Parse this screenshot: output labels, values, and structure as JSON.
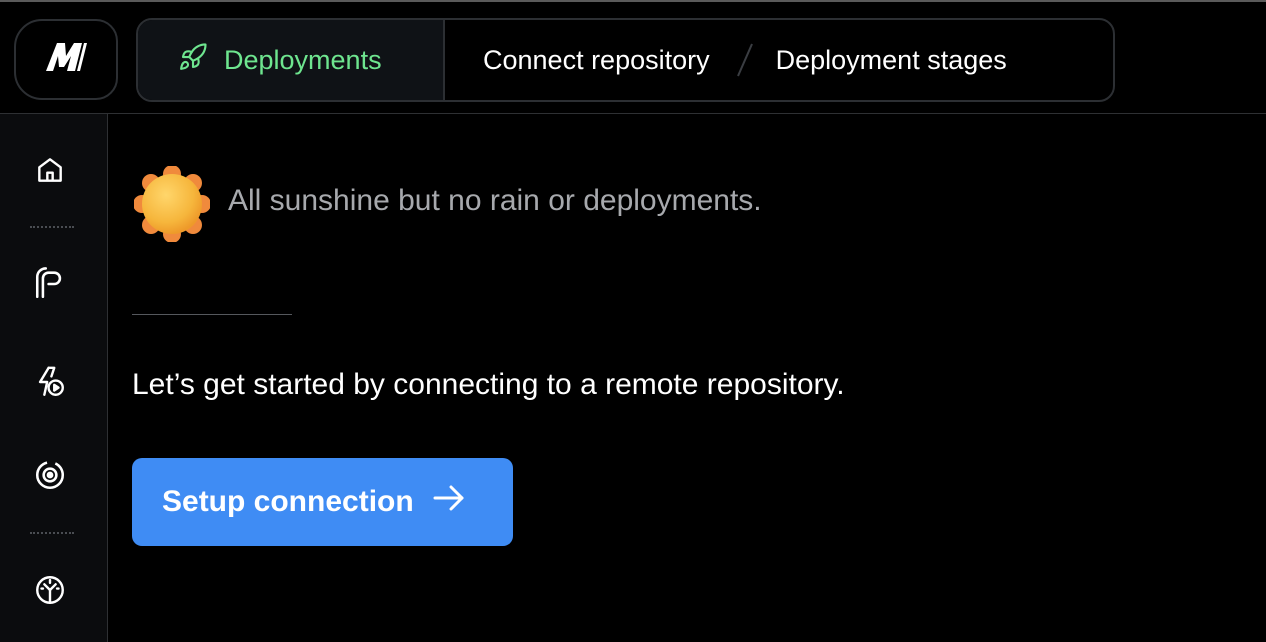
{
  "header": {
    "logo_icon": "brand-logo-icon",
    "tabs": [
      {
        "label": "Deployments",
        "icon": "rocket-icon",
        "active": true,
        "color": "#6ee58f"
      },
      {
        "label": "Connect repository"
      },
      {
        "label": "Deployment stages"
      }
    ],
    "separator_icon": "slash-separator-icon"
  },
  "sidebar": {
    "items": [
      {
        "icon": "home-icon"
      },
      {
        "icon": "pipeline-icon"
      },
      {
        "icon": "lightning-play-icon"
      },
      {
        "icon": "target-icon"
      },
      {
        "icon": "dashboard-gauge-icon"
      }
    ]
  },
  "main": {
    "status_icon": "sun-icon",
    "status_text": "All sunshine but no rain or deployments.",
    "intro_text": "Let’s get started by connecting to a remote repository.",
    "cta": {
      "label": "Setup connection",
      "icon": "arrow-right-icon",
      "color": "#3f8cf4"
    }
  }
}
